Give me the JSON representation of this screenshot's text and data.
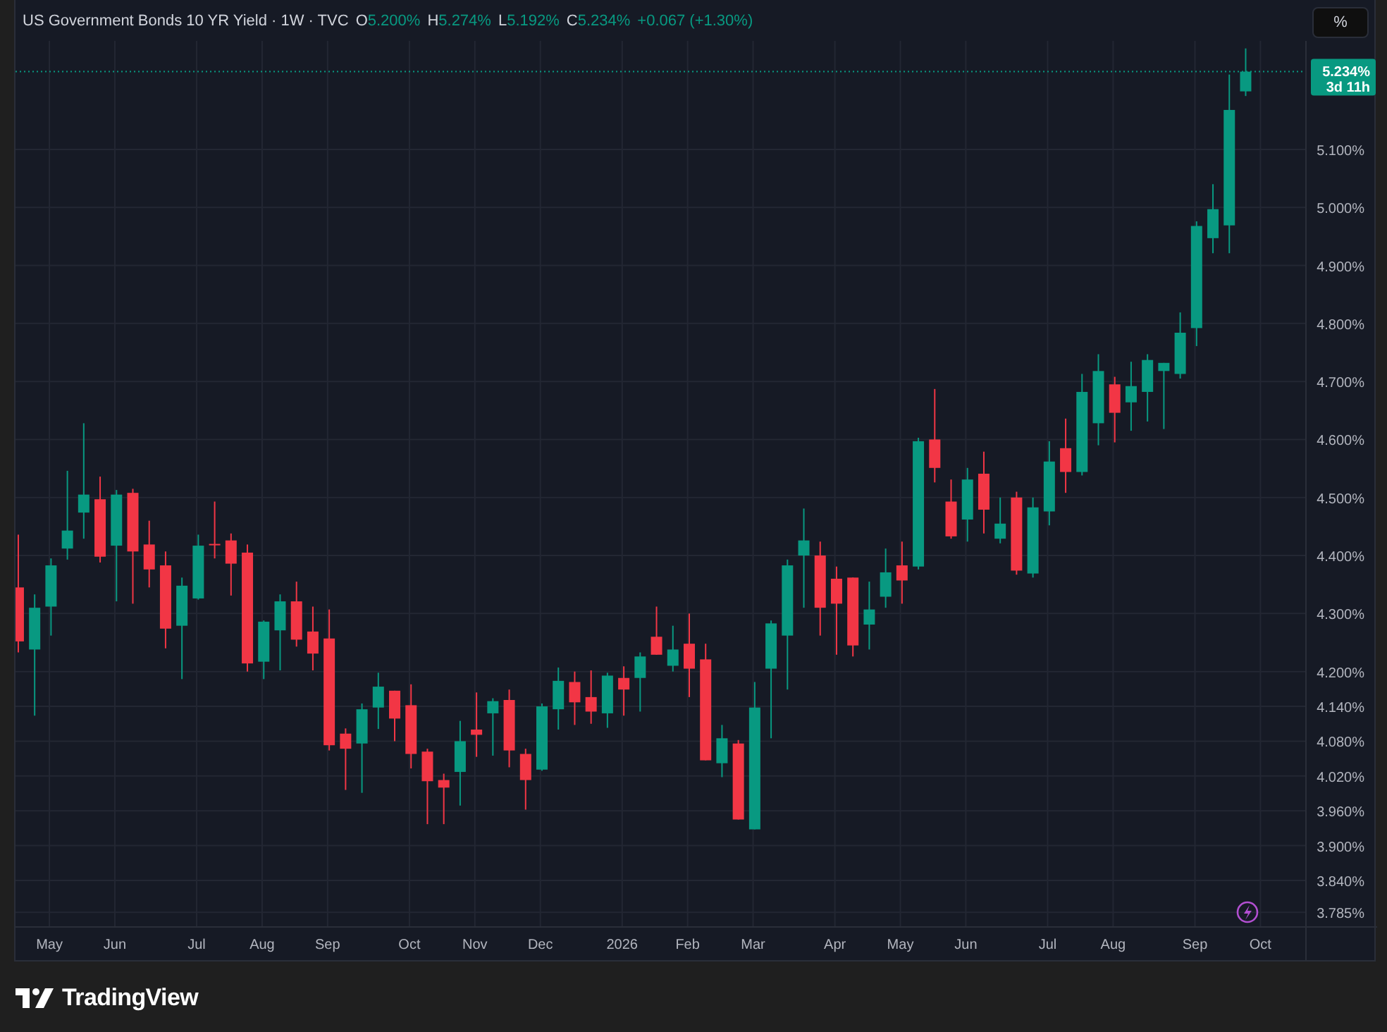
{
  "header": {
    "title": "US Government Bonds 10 YR Yield · 1W · TVC",
    "ohlc": [
      {
        "label": "O",
        "value": "5.200%"
      },
      {
        "label": "H",
        "value": "5.274%"
      },
      {
        "label": "L",
        "value": "5.192%"
      },
      {
        "label": "C",
        "value": "5.234%"
      }
    ],
    "change": "+0.067 (+1.30%)",
    "unit_button": "%"
  },
  "chart": {
    "chart_data": {
      "type": "candlestick",
      "ylim": [
        3.761,
        5.287
      ],
      "categories": [
        null,
        null,
        "May",
        null,
        null,
        null,
        "Jun",
        null,
        null,
        null,
        null,
        "Jul",
        null,
        null,
        null,
        "Aug",
        null,
        null,
        null,
        "Sep",
        null,
        null,
        null,
        null,
        "Oct",
        null,
        null,
        null,
        "Nov",
        null,
        null,
        null,
        "Dec",
        null,
        null,
        null,
        null,
        "2026",
        null,
        null,
        null,
        "Feb",
        null,
        null,
        null,
        "Mar",
        null,
        null,
        null,
        null,
        "Apr",
        null,
        null,
        null,
        "May",
        null,
        null,
        null,
        "Jun",
        null,
        null,
        null,
        null,
        "Jul",
        null,
        null,
        null,
        "Aug",
        null,
        null,
        null,
        null,
        "Sep",
        null,
        null,
        null,
        "Oct"
      ],
      "ohlc": [
        [
          4.345,
          4.436,
          4.233,
          4.252
        ],
        [
          4.238,
          4.333,
          4.124,
          4.31
        ],
        [
          4.312,
          4.395,
          4.262,
          4.383
        ],
        [
          4.412,
          4.546,
          4.393,
          4.443
        ],
        [
          4.474,
          4.628,
          4.429,
          4.505
        ],
        [
          4.497,
          4.536,
          4.388,
          4.398
        ],
        [
          4.417,
          4.513,
          4.321,
          4.505
        ],
        [
          4.508,
          4.515,
          4.317,
          4.407
        ],
        [
          4.419,
          4.46,
          4.345,
          4.376
        ],
        [
          4.383,
          4.407,
          4.24,
          4.274
        ],
        [
          4.279,
          4.362,
          4.187,
          4.348
        ],
        [
          4.326,
          4.436,
          4.324,
          4.417
        ],
        [
          4.42,
          4.493,
          4.395,
          4.418
        ],
        [
          4.426,
          4.438,
          4.331,
          4.386
        ],
        [
          4.405,
          4.419,
          4.2,
          4.214
        ],
        [
          4.217,
          4.288,
          4.187,
          4.286
        ],
        [
          4.271,
          4.333,
          4.202,
          4.321
        ],
        [
          4.321,
          4.355,
          4.243,
          4.255
        ],
        [
          4.269,
          4.312,
          4.202,
          4.231
        ],
        [
          4.257,
          4.307,
          4.064,
          4.073
        ],
        [
          4.093,
          4.102,
          3.996,
          4.067
        ],
        [
          4.076,
          4.145,
          3.991,
          4.135
        ],
        [
          4.138,
          4.198,
          4.101,
          4.174
        ],
        [
          4.167,
          4.167,
          4.08,
          4.119
        ],
        [
          4.142,
          4.178,
          4.033,
          4.058
        ],
        [
          4.062,
          4.067,
          3.937,
          4.011
        ],
        [
          4.013,
          4.024,
          3.937,
          4.0
        ],
        [
          4.027,
          4.115,
          3.969,
          4.08
        ],
        [
          4.1,
          4.164,
          4.053,
          4.091
        ],
        [
          4.128,
          4.154,
          4.055,
          4.149
        ],
        [
          4.151,
          4.169,
          4.035,
          4.064
        ],
        [
          4.058,
          4.067,
          3.962,
          4.013
        ],
        [
          4.031,
          4.145,
          4.029,
          4.14
        ],
        [
          4.135,
          4.207,
          4.1,
          4.184
        ],
        [
          4.182,
          4.2,
          4.108,
          4.147
        ],
        [
          4.156,
          4.202,
          4.11,
          4.131
        ],
        [
          4.128,
          4.198,
          4.103,
          4.193
        ],
        [
          4.189,
          4.209,
          4.124,
          4.169
        ],
        [
          4.189,
          4.233,
          4.131,
          4.226
        ],
        [
          4.26,
          4.312,
          4.229,
          4.229
        ],
        [
          4.21,
          4.279,
          4.2,
          4.238
        ],
        [
          4.248,
          4.3,
          4.156,
          4.205
        ],
        [
          4.221,
          4.248,
          4.047,
          4.047
        ],
        [
          4.042,
          4.108,
          4.018,
          4.085
        ],
        [
          4.076,
          4.082,
          3.945,
          3.945
        ],
        [
          3.928,
          4.182,
          3.928,
          4.138
        ],
        [
          4.205,
          4.288,
          4.085,
          4.283
        ],
        [
          4.262,
          4.393,
          4.169,
          4.383
        ],
        [
          4.4,
          4.481,
          4.31,
          4.426
        ],
        [
          4.4,
          4.424,
          4.262,
          4.31
        ],
        [
          4.36,
          4.381,
          4.229,
          4.317
        ],
        [
          4.362,
          4.362,
          4.226,
          4.245
        ],
        [
          4.281,
          4.355,
          4.238,
          4.307
        ],
        [
          4.329,
          4.412,
          4.31,
          4.371
        ],
        [
          4.383,
          4.424,
          4.317,
          4.357
        ],
        [
          4.381,
          4.603,
          4.376,
          4.597
        ],
        [
          4.6,
          4.687,
          4.526,
          4.551
        ],
        [
          4.493,
          4.531,
          4.429,
          4.433
        ],
        [
          4.462,
          4.551,
          4.424,
          4.531
        ],
        [
          4.541,
          4.579,
          4.438,
          4.479
        ],
        [
          4.429,
          4.5,
          4.421,
          4.455
        ],
        [
          4.5,
          4.51,
          4.367,
          4.374
        ],
        [
          4.369,
          4.5,
          4.362,
          4.483
        ],
        [
          4.476,
          4.597,
          4.452,
          4.562
        ],
        [
          4.585,
          4.636,
          4.508,
          4.544
        ],
        [
          4.544,
          4.713,
          4.538,
          4.682
        ],
        [
          4.628,
          4.747,
          4.59,
          4.718
        ],
        [
          4.695,
          4.708,
          4.595,
          4.646
        ],
        [
          4.664,
          4.734,
          4.615,
          4.692
        ],
        [
          4.682,
          4.747,
          4.631,
          4.737
        ],
        [
          4.718,
          4.732,
          4.618,
          4.732
        ],
        [
          4.713,
          4.819,
          4.705,
          4.784
        ],
        [
          4.792,
          4.976,
          4.761,
          4.968
        ],
        [
          4.947,
          5.04,
          4.921,
          4.997
        ],
        [
          4.969,
          5.229,
          4.921,
          5.168
        ],
        [
          5.2,
          5.274,
          5.192,
          5.234
        ],
        null
      ],
      "yticks": [
        {
          "value": 5.1,
          "label": "5.100%"
        },
        {
          "value": 5.0,
          "label": "5.000%"
        },
        {
          "value": 4.9,
          "label": "4.900%"
        },
        {
          "value": 4.8,
          "label": "4.800%"
        },
        {
          "value": 4.7,
          "label": "4.700%"
        },
        {
          "value": 4.6,
          "label": "4.600%"
        },
        {
          "value": 4.5,
          "label": "4.500%"
        },
        {
          "value": 4.4,
          "label": "4.400%"
        },
        {
          "value": 4.3,
          "label": "4.300%"
        },
        {
          "value": 4.2,
          "label": "4.200%"
        },
        {
          "value": 4.14,
          "label": "4.140%"
        },
        {
          "value": 4.08,
          "label": "4.080%"
        },
        {
          "value": 4.02,
          "label": "4.020%"
        },
        {
          "value": 3.96,
          "label": "3.960%"
        },
        {
          "value": 3.9,
          "label": "3.900%"
        },
        {
          "value": 3.84,
          "label": "3.840%"
        },
        {
          "value": 3.785,
          "label": "3.785%"
        }
      ],
      "grid": true,
      "ref_lines": [
        {
          "axis": "y",
          "value": 5.234
        }
      ]
    },
    "last_price": {
      "value_label": "5.234%",
      "countdown": "3d 11h"
    }
  },
  "footer": {
    "brand": "TradingView"
  }
}
